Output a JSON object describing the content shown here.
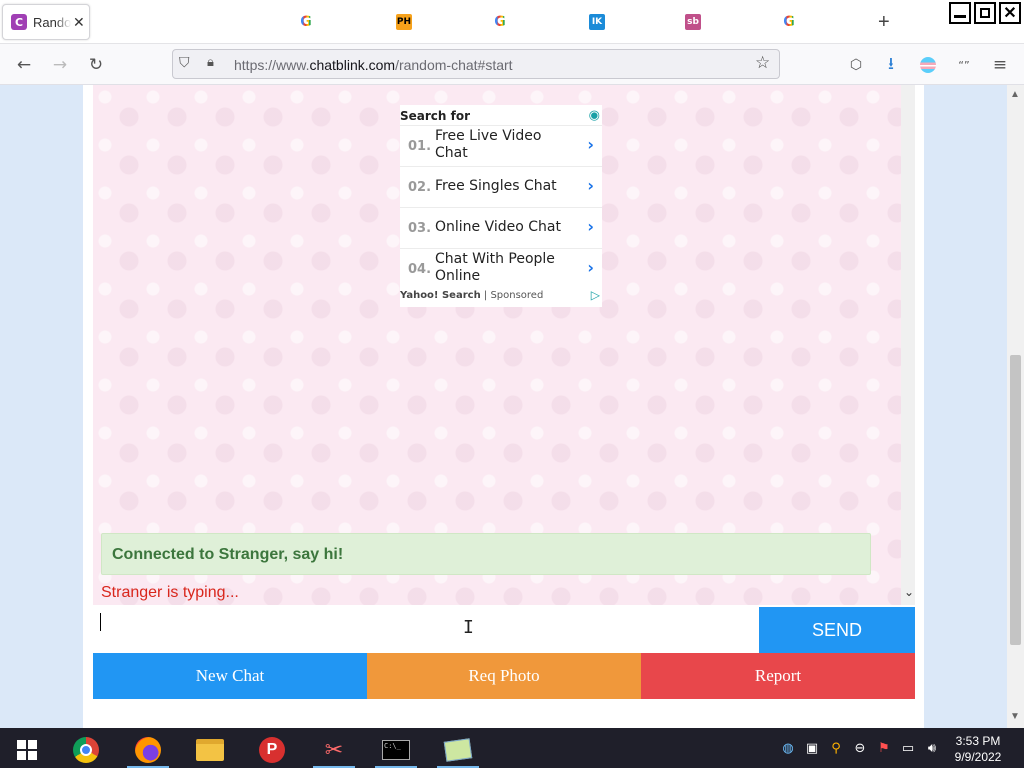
{
  "browser": {
    "active_tab": {
      "title": "Random Chat",
      "favicon_letter": "C"
    },
    "pinned_tabs": [
      {
        "name": "google",
        "label": "G"
      },
      {
        "name": "ph",
        "label": "PH"
      },
      {
        "name": "google",
        "label": "G"
      },
      {
        "name": "ik",
        "label": "IK"
      },
      {
        "name": "sb",
        "label": "sb"
      },
      {
        "name": "google",
        "label": "G"
      }
    ],
    "url": {
      "prefix": "https://www.",
      "host": "chatblink.com",
      "path": "/random-chat#start"
    }
  },
  "ad": {
    "header": "Search for",
    "items": [
      {
        "num": "01.",
        "text": "Free Live Video Chat"
      },
      {
        "num": "02.",
        "text": "Free Singles Chat"
      },
      {
        "num": "03.",
        "text": "Online Video Chat"
      },
      {
        "num": "04.",
        "text": "Chat With People Online"
      }
    ],
    "footer_brand": "Yahoo! Search",
    "footer_sep": "|",
    "footer_label": "Sponsored"
  },
  "chat": {
    "connected_text": "Connected to Stranger, say hi!",
    "typing_text": "Stranger is typing...",
    "input_value": "",
    "send_label": "SEND"
  },
  "actions": {
    "new_chat": "New Chat",
    "req_photo": "Req Photo",
    "report": "Report"
  },
  "colors": {
    "send": "#2196f3",
    "new_chat": "#2196f3",
    "req_photo": "#f0983b",
    "report": "#e8474b",
    "connected_bg": "#dff0d8",
    "typing": "#d9261c"
  },
  "taskbar": {
    "time": "3:53 PM",
    "date": "9/9/2022"
  }
}
